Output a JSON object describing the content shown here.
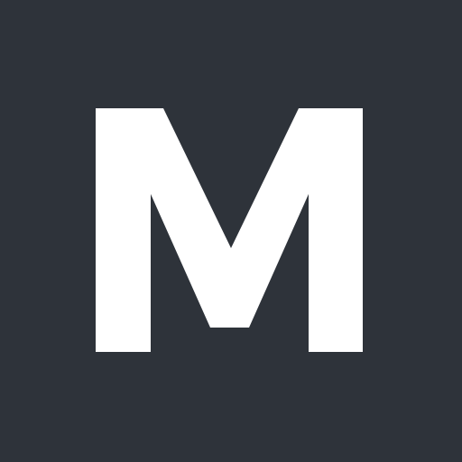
{
  "logo": {
    "letter": "M",
    "background_color": "#2e333a",
    "letter_color": "#ffffff"
  }
}
